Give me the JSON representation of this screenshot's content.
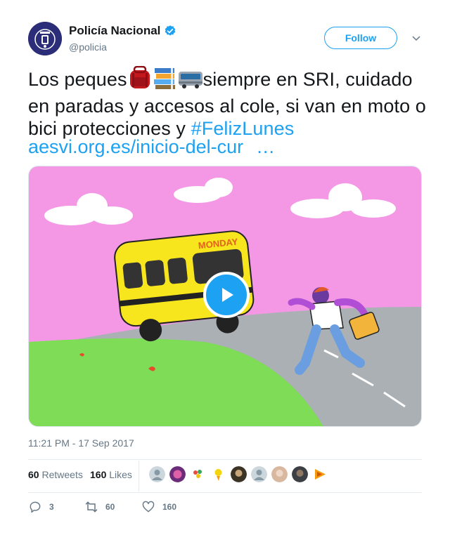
{
  "account": {
    "display_name": "Policía Nacional",
    "handle": "@policia",
    "verified": true
  },
  "follow_label": "Follow",
  "tweet": {
    "text_before": "Los peques",
    "emojis": [
      "backpack-emoji",
      "books-emoji",
      "bus-emoji"
    ],
    "text_after": "siempre en SRI, cuidado en paradas y accesos al cole, si van en moto o bici protecciones y ",
    "hashtag": "#FelizLunes",
    "link": "aesvi.org.es/inicio-del-cur",
    "link_ellipsis": "…"
  },
  "media": {
    "bus_label": "MONDAY",
    "play_icon": "play-icon"
  },
  "timestamp": "11:21 PM - 17 Sep 2017",
  "stats": {
    "retweets_count": "60",
    "retweets_label": "Retweets",
    "likes_count": "160",
    "likes_label": "Likes"
  },
  "actions": {
    "reply_count": "3",
    "retweet_count": "60",
    "like_count": "160"
  },
  "colors": {
    "accent": "#1da1f2",
    "text": "#14171a",
    "secondary": "#657786"
  }
}
